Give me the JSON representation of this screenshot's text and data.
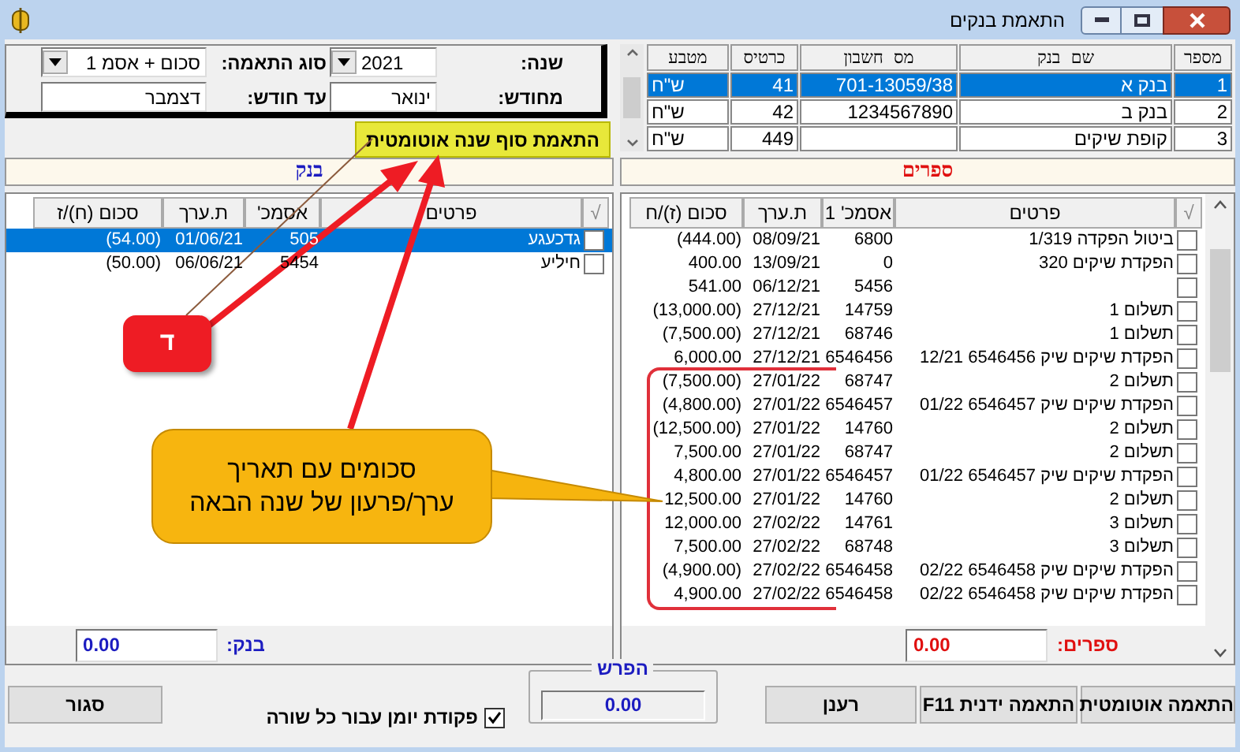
{
  "window": {
    "title": "התאמת בנקים"
  },
  "filters": [
    {
      "label": "שנה:",
      "value": "2021",
      "dropdown": true
    },
    {
      "label": "סוג התאמה:",
      "value": "סכום + אסמ 1",
      "dropdown": true
    },
    {
      "label": "מחודש:",
      "value": "ינואר",
      "dropdown": false
    },
    {
      "label": "עד חודש:",
      "value": "דצמבר",
      "dropdown": false
    }
  ],
  "year_end_button": "התאמת סוף שנה אוטומטית",
  "banks": {
    "columns": [
      "מספר",
      "שם בנק",
      "מס חשבון",
      "כרטיס",
      "מטבע"
    ],
    "rows": [
      {
        "number": "1",
        "name": "בנק א",
        "account": "701-13059/38",
        "card": "41",
        "currency": "ש\"ח",
        "selected": true
      },
      {
        "number": "2",
        "name": "בנק ב",
        "account": "1234567890",
        "card": "42",
        "currency": "ש\"ח",
        "selected": false
      },
      {
        "number": "3",
        "name": "קופת שיקים",
        "account": "",
        "card": "449",
        "currency": "ש\"ח",
        "selected": false
      }
    ]
  },
  "books": {
    "title": "ספרים",
    "columns": [
      "√",
      "פרטים",
      "אסמכ' 1",
      "ת.ערך",
      "סכום (ז)/ח"
    ],
    "rows": [
      {
        "checked": false,
        "selected": false,
        "details": "ביטול הפקדה 1/319",
        "ref": "6800",
        "date": "08/09/21",
        "amount": "(444.00)"
      },
      {
        "checked": false,
        "selected": false,
        "details": "הפקדת שיקים 320",
        "ref": "0",
        "date": "13/09/21",
        "amount": "400.00"
      },
      {
        "checked": false,
        "selected": false,
        "details": "",
        "ref": "5456",
        "date": "06/12/21",
        "amount": "541.00"
      },
      {
        "checked": false,
        "selected": false,
        "details": "תשלום 1",
        "ref": "14759",
        "date": "27/12/21",
        "amount": "(13,000.00)"
      },
      {
        "checked": false,
        "selected": false,
        "details": "תשלום 1",
        "ref": "68746",
        "date": "27/12/21",
        "amount": "(7,500.00)"
      },
      {
        "checked": false,
        "selected": false,
        "details": "הפקדת שיקים שיק 6546456 12/21",
        "ref": "6546456",
        "date": "27/12/21",
        "amount": "6,000.00"
      },
      {
        "checked": false,
        "selected": false,
        "details": "תשלום 2",
        "ref": "68747",
        "date": "27/01/22",
        "amount": "(7,500.00)"
      },
      {
        "checked": false,
        "selected": false,
        "details": "הפקדת שיקים שיק 6546457 01/22",
        "ref": "6546457",
        "date": "27/01/22",
        "amount": "(4,800.00)"
      },
      {
        "checked": false,
        "selected": false,
        "details": "תשלום 2",
        "ref": "14760",
        "date": "27/01/22",
        "amount": "(12,500.00)"
      },
      {
        "checked": false,
        "selected": false,
        "details": "תשלום 2",
        "ref": "68747",
        "date": "27/01/22",
        "amount": "7,500.00"
      },
      {
        "checked": false,
        "selected": false,
        "details": "הפקדת שיקים שיק 6546457 01/22",
        "ref": "6546457",
        "date": "27/01/22",
        "amount": "4,800.00"
      },
      {
        "checked": false,
        "selected": false,
        "details": "תשלום 2",
        "ref": "14760",
        "date": "27/01/22",
        "amount": "12,500.00"
      },
      {
        "checked": false,
        "selected": false,
        "details": "תשלום 3",
        "ref": "14761",
        "date": "27/02/22",
        "amount": "12,000.00"
      },
      {
        "checked": false,
        "selected": false,
        "details": "תשלום 3",
        "ref": "68748",
        "date": "27/02/22",
        "amount": "7,500.00"
      },
      {
        "checked": false,
        "selected": false,
        "details": "הפקדת שיקים שיק 6546458 02/22",
        "ref": "6546458",
        "date": "27/02/22",
        "amount": "(4,900.00)"
      },
      {
        "checked": false,
        "selected": false,
        "details": "הפקדת שיקים שיק 6546458 02/22",
        "ref": "6546458",
        "date": "27/02/22",
        "amount": "4,900.00"
      }
    ],
    "total_label": "ספרים:",
    "total_value": "0.00"
  },
  "bank": {
    "title": "בנק",
    "columns": [
      "√",
      "פרטים",
      "אסמכ'",
      "ת.ערך",
      "סכום (ח)/ז"
    ],
    "rows": [
      {
        "checked": false,
        "selected": true,
        "details": "גדכעגע",
        "ref": "505",
        "date": "01/06/21",
        "amount": "(54.00)"
      },
      {
        "checked": false,
        "selected": false,
        "details": "חיליע",
        "ref": "5454",
        "date": "06/06/21",
        "amount": "(50.00)"
      }
    ],
    "total_label": "בנק:",
    "total_value": "0.00"
  },
  "action_buttons": [
    "התאמה אוטומטית",
    "התאמה ידנית F11",
    "רענן"
  ],
  "difference": {
    "title": "הפרש",
    "value": "0.00"
  },
  "journal_checkbox": {
    "label": "פקודת יומן עבור כל שורה",
    "checked": true
  },
  "close_button": "סגור",
  "annotations": {
    "badge": "ד",
    "callout": [
      "סכומים עם תאריך",
      "ערך/פרעון של שנה הבאה"
    ]
  }
}
